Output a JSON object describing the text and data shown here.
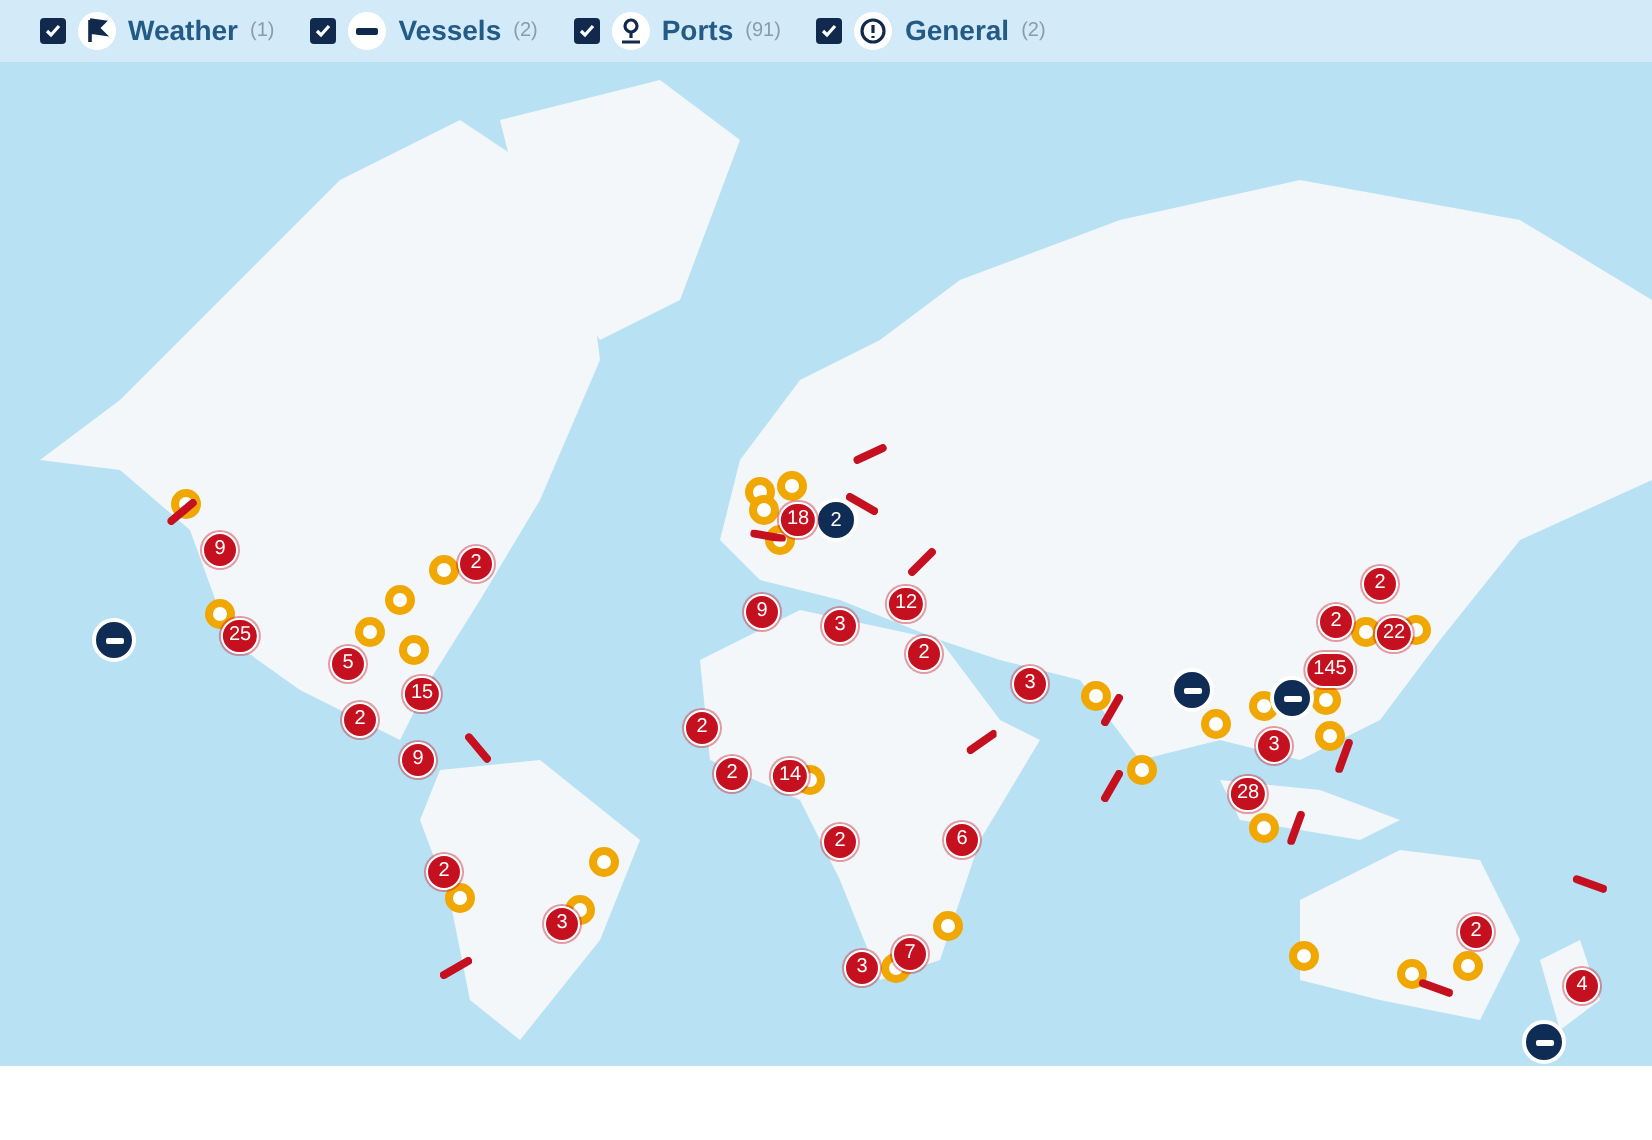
{
  "filters": [
    {
      "label": "Weather",
      "count": "(1)",
      "checked": true
    },
    {
      "label": "Vessels",
      "count": "(2)",
      "checked": true
    },
    {
      "label": "Ports",
      "count": "(91)",
      "checked": true
    },
    {
      "label": "General",
      "count": "(2)",
      "checked": true
    }
  ],
  "map": {
    "markers": [
      {
        "kind": "cluster",
        "count": "9"
      },
      {
        "kind": "cluster",
        "count": "25"
      },
      {
        "kind": "cluster",
        "count": "5"
      },
      {
        "kind": "cluster",
        "count": "15"
      },
      {
        "kind": "cluster",
        "count": "2"
      },
      {
        "kind": "cluster",
        "count": "9"
      },
      {
        "kind": "cluster",
        "count": "2"
      },
      {
        "kind": "cluster",
        "count": "2"
      },
      {
        "kind": "cluster",
        "count": "3"
      },
      {
        "kind": "cluster",
        "count": "18"
      },
      {
        "kind": "cluster",
        "count": "9"
      },
      {
        "kind": "cluster",
        "count": "3"
      },
      {
        "kind": "cluster",
        "count": "12"
      },
      {
        "kind": "cluster",
        "count": "2"
      },
      {
        "kind": "cluster",
        "count": "3"
      },
      {
        "kind": "cluster",
        "count": "2"
      },
      {
        "kind": "cluster",
        "count": "2"
      },
      {
        "kind": "cluster",
        "count": "14"
      },
      {
        "kind": "cluster",
        "count": "2"
      },
      {
        "kind": "cluster",
        "count": "6"
      },
      {
        "kind": "cluster",
        "count": "3"
      },
      {
        "kind": "cluster",
        "count": "7"
      },
      {
        "kind": "cluster",
        "count": "2"
      },
      {
        "kind": "cluster",
        "count": "145"
      },
      {
        "kind": "cluster",
        "count": "22"
      },
      {
        "kind": "cluster",
        "count": "2"
      },
      {
        "kind": "cluster",
        "count": "3"
      },
      {
        "kind": "cluster",
        "count": "28"
      },
      {
        "kind": "cluster",
        "count": "2"
      },
      {
        "kind": "cluster",
        "count": "4"
      },
      {
        "kind": "vessel"
      },
      {
        "kind": "vessel"
      },
      {
        "kind": "vessel",
        "count": "2"
      },
      {
        "kind": "vessel"
      },
      {
        "kind": "vessel"
      }
    ]
  }
}
